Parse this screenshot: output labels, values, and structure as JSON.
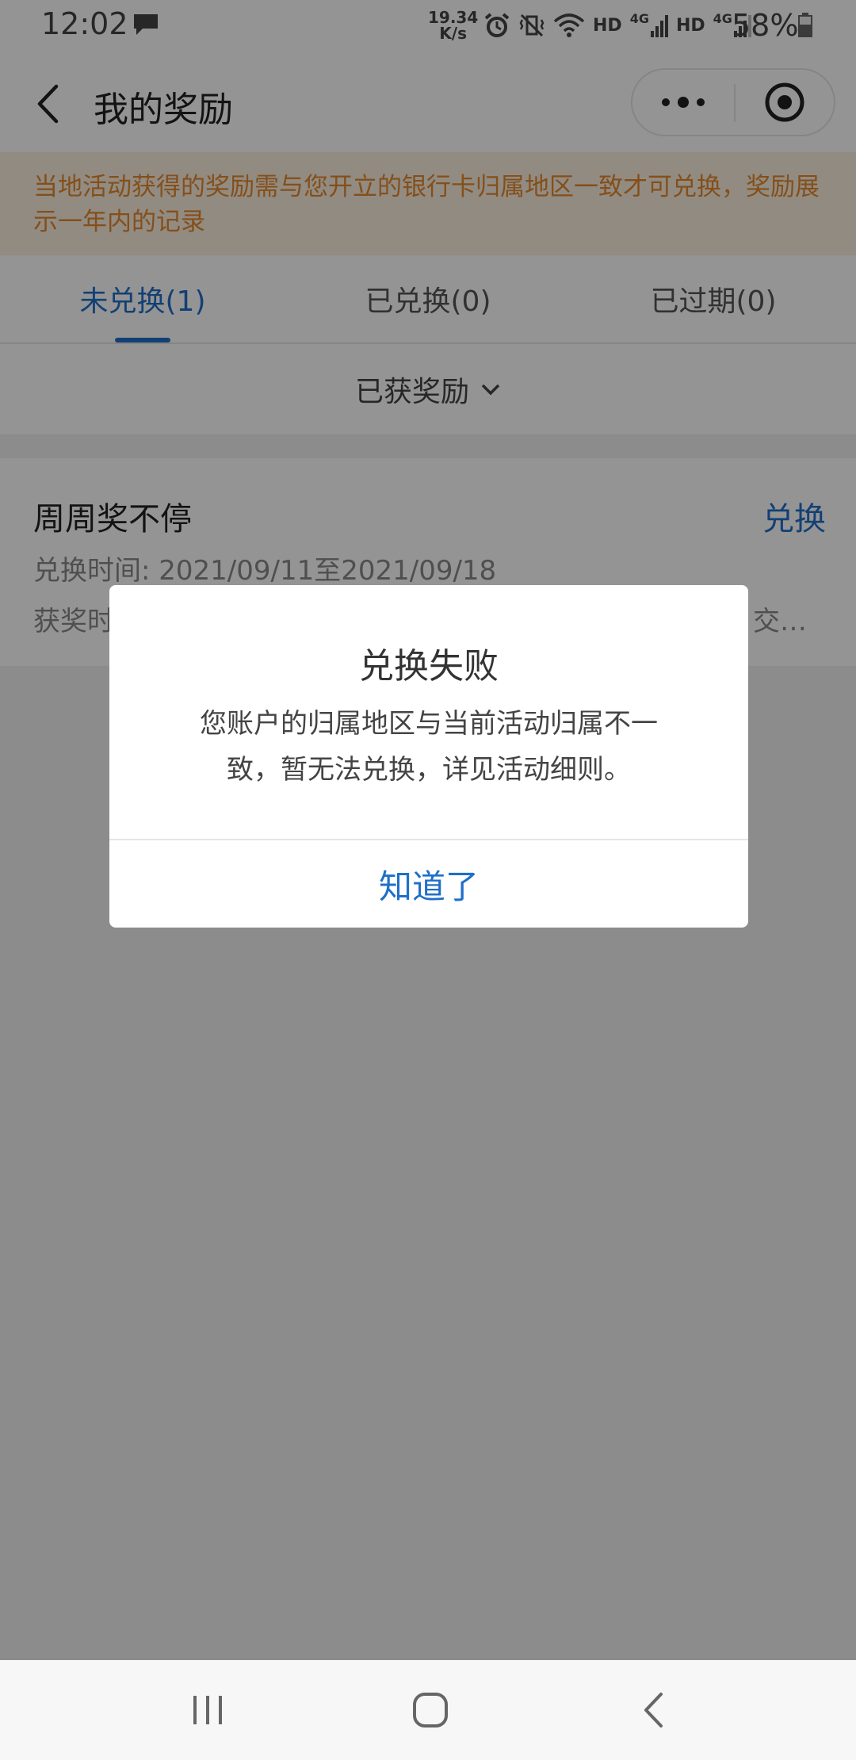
{
  "status_bar": {
    "time": "12:02",
    "net_speed_value": "19.34",
    "net_speed_unit": "K/s",
    "signal_label_1": "HD",
    "network_1": "4G",
    "signal_label_2": "HD",
    "network_2": "4G",
    "battery": "58%"
  },
  "header": {
    "title": "我的奖励"
  },
  "notice": {
    "text": "当地活动获得的奖励需与您开立的银行卡归属地区一致才可兑换，奖励展示一年内的记录"
  },
  "tabs": [
    {
      "label": "未兑换(1)",
      "active": true
    },
    {
      "label": "已兑换(0)",
      "active": false
    },
    {
      "label": "已过期(0)",
      "active": false
    }
  ],
  "filter": {
    "label": "已获奖励"
  },
  "reward": {
    "title": "周周奖不停",
    "action_label": "兑换",
    "redeem_time": "兑换时间: 2021/09/11至2021/09/18",
    "award_time_visible_start": "获奖时",
    "award_time_visible_end": "交…"
  },
  "dialog": {
    "title": "兑换失败",
    "message_line1": "您账户的归属地区与当前活动归属不一",
    "message_line2": "致，暂无法兑换，详见活动细则。",
    "confirm_label": "知道了"
  },
  "colors": {
    "accent": "#1f6fc8",
    "notice_text": "#e3892c",
    "notice_bg": "#fcefe0"
  }
}
